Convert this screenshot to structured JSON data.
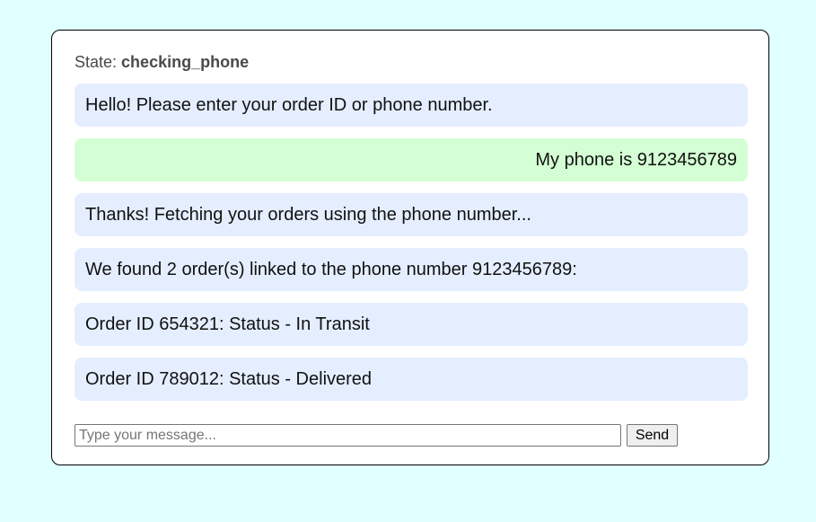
{
  "state": {
    "label": "State:",
    "value": "checking_phone"
  },
  "messages": [
    {
      "sender": "bot",
      "text": "Hello! Please enter your order ID or phone number."
    },
    {
      "sender": "user",
      "text": "My phone is 9123456789"
    },
    {
      "sender": "bot",
      "text": "Thanks! Fetching your orders using the phone number..."
    },
    {
      "sender": "bot",
      "text": "We found 2 order(s) linked to the phone number 9123456789:"
    },
    {
      "sender": "bot",
      "text": "Order ID 654321: Status - In Transit"
    },
    {
      "sender": "bot",
      "text": "Order ID 789012: Status - Delivered"
    }
  ],
  "composer": {
    "value": "",
    "placeholder": "Type your message...",
    "send_label": "Send"
  },
  "colors": {
    "page_background": "#e0ffff",
    "bot_bubble": "#e4eeff",
    "user_bubble": "#d4ffd4"
  }
}
